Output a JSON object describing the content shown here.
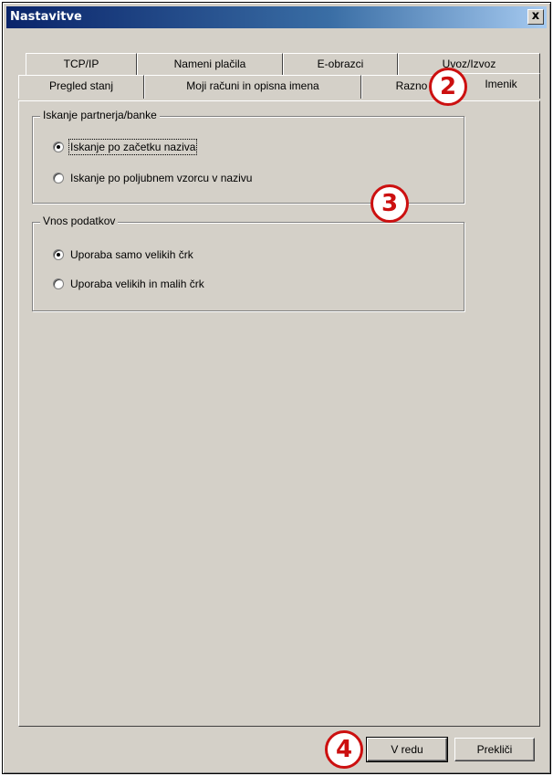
{
  "window": {
    "title": "Nastavitve",
    "close_glyph": "x"
  },
  "tabs": {
    "back_row": [
      "TCP/IP",
      "Nameni plačila",
      "E-obrazci",
      "Uvoz/Izvoz"
    ],
    "front_row": [
      "Pregled stanj",
      "Moji računi in opisna imena",
      "Razno",
      "Imenik"
    ],
    "active": "Imenik"
  },
  "search_group": {
    "title": "Iskanje partnerja/banke",
    "options": [
      {
        "label": "Iskanje po začetku naziva",
        "checked": true
      },
      {
        "label": "Iskanje po poljubnem vzorcu v nazivu",
        "checked": false
      }
    ]
  },
  "input_group": {
    "title": "Vnos podatkov",
    "options": [
      {
        "label": "Uporaba samo velikih črk",
        "checked": true
      },
      {
        "label": "Uporaba velikih in malih črk",
        "checked": false
      }
    ]
  },
  "buttons": {
    "ok": "V redu",
    "cancel": "Prekliči"
  },
  "callouts": [
    "2",
    "3",
    "4"
  ]
}
